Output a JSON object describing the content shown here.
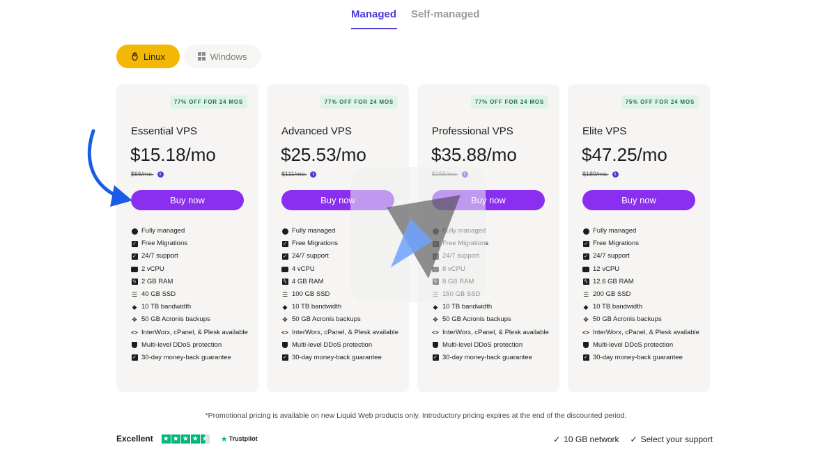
{
  "tabs": {
    "managed": "Managed",
    "self_managed": "Self-managed"
  },
  "os": {
    "linux": "Linux",
    "windows": "Windows"
  },
  "plans": [
    {
      "badge": "77% OFF FOR 24 MOS",
      "name": "Essential VPS",
      "price": "$15.18/mo",
      "old_price": "$66/mo.",
      "buy": "Buy now",
      "features": [
        "Fully managed",
        "Free Migrations",
        "24/7 support",
        "2 vCPU",
        "2 GB RAM",
        "40 GB SSD",
        "10 TB bandwidth",
        "50 GB Acronis backups",
        "InterWorx, cPanel, & Plesk available",
        "Multi-level DDoS protection",
        "30-day money-back guarantee"
      ]
    },
    {
      "badge": "77% OFF FOR 24 MOS",
      "name": "Advanced VPS",
      "price": "$25.53/mo",
      "old_price": "$111/mo.",
      "buy": "Buy now",
      "features": [
        "Fully managed",
        "Free Migrations",
        "24/7 support",
        "4 vCPU",
        "4 GB RAM",
        "100 GB SSD",
        "10 TB bandwidth",
        "50 GB Acronis backups",
        "InterWorx, cPanel, & Plesk available",
        "Multi-level DDoS protection",
        "30-day money-back guarantee"
      ]
    },
    {
      "badge": "77% OFF FOR 24 MOS",
      "name": "Professional VPS",
      "price": "$35.88/mo",
      "old_price": "$156/mo.",
      "buy": "Buy now",
      "features": [
        "Fully managed",
        "Free Migrations",
        "24/7 support",
        "8 vCPU",
        "8 GB RAM",
        "150 GB SSD",
        "10 TB bandwidth",
        "50 GB Acronis backups",
        "InterWorx, cPanel, & Plesk available",
        "Multi-level DDoS protection",
        "30-day money-back guarantee"
      ]
    },
    {
      "badge": "75% OFF FOR 24 MOS",
      "name": "Elite VPS",
      "price": "$47.25/mo",
      "old_price": "$189/mo.",
      "buy": "Buy now",
      "features": [
        "Fully managed",
        "Free Migrations",
        "24/7 support",
        "12 vCPU",
        "12.6 GB RAM",
        "200 GB SSD",
        "10 TB bandwidth",
        "50 GB Acronis backups",
        "InterWorx, cPanel, & Plesk available",
        "Multi-level DDoS protection",
        "30-day money-back guarantee"
      ]
    }
  ],
  "feature_icons": [
    "user-circle-icon",
    "checkbox-icon",
    "checkbox-icon",
    "server-icon",
    "bolt-icon",
    "storage-icon",
    "wifi-icon",
    "backup-icon",
    "code-icon",
    "shield-icon",
    "checkbox-icon"
  ],
  "footnote": "*Promotional pricing is available on new Liquid Web products only. Introductory pricing expires at the end of the discounted period.",
  "trustpilot": {
    "rating_label": "Excellent",
    "stars": 4.5,
    "logo": "Trustpilot"
  },
  "perks": [
    "10 GB network",
    "Select your support"
  ],
  "colors": {
    "accent": "#4a3ad6",
    "buy_button": "#8a2ff0",
    "linux_toggle": "#f3b806",
    "badge_bg": "#dff3e9",
    "trustpilot_green": "#00b67a",
    "arrow": "#1a5ce6"
  }
}
